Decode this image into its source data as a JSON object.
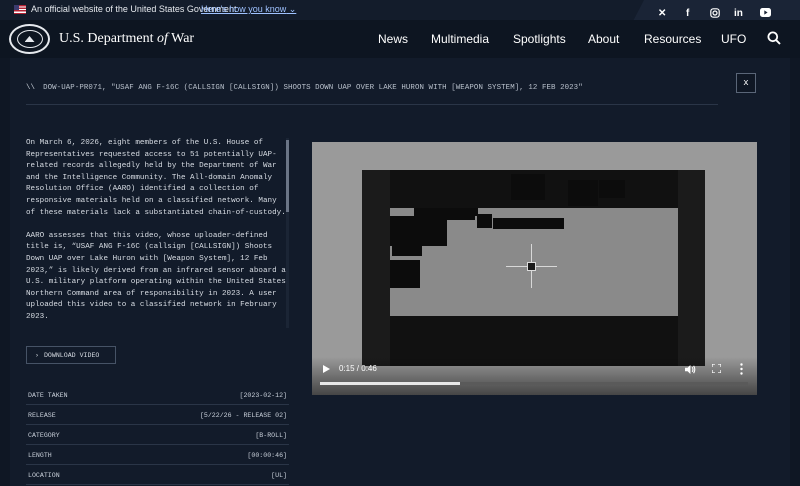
{
  "gov_banner": {
    "text": "An official website of the United States Government",
    "link": "Here's how you know",
    "social": [
      "X",
      "f",
      "instagram",
      "in",
      "youtube"
    ]
  },
  "header": {
    "site_title_pre": "U.S. Department ",
    "site_title_of": "of",
    "site_title_post": " War",
    "nav": [
      "News",
      "Multimedia",
      "Spotlights",
      "About",
      "Resources",
      "UFO"
    ]
  },
  "record": {
    "breadcrumb_slashes": "\\\\",
    "breadcrumb": "DOW-UAP-PR071, \"USAF ANG F-16C (CALLSIGN [CALLSIGN]) SHOOTS DOWN UAP OVER LAKE HURON WITH [WEAPON SYSTEM], 12 FEB 2023\"",
    "close_label": "x",
    "description": [
      "On March 6, 2026, eight members of the U.S. House of Representatives requested access to 51 potentially UAP-related records allegedly held by the Department of War and the Intelligence Community. The All-domain Anomaly Resolution Office (AARO) identified a collection of responsive materials held on a classified network. Many of these materials lack a substantiated chain-of-custody.",
      "AARO assesses that this video, whose uploader-defined title is, “USAF ANG F-16C (callsign [CALLSIGN]) Shoots Down UAP over Lake Huron with [Weapon System], 12 Feb 2023,” is likely derived from an infrared sensor aboard a U.S. military platform operating within the United States Northern Command area of responsibility in 2023. A user uploaded this video to a classified network in February 2023."
    ],
    "download_label": "DOWNLOAD VIDEO",
    "meta": [
      {
        "key": "DATE TAKEN",
        "value": "[2023-02-12]"
      },
      {
        "key": "RELEASE",
        "value": "[5/22/26 - RELEASE 02]"
      },
      {
        "key": "CATEGORY",
        "value": "[B-ROLL]"
      },
      {
        "key": "LENGTH",
        "value": "[00:00:46]"
      },
      {
        "key": "LOCATION",
        "value": "[UL]"
      }
    ]
  },
  "video": {
    "time": "0:15 / 0:46",
    "progress": 0.326
  },
  "colors": {
    "page_bg": "#0f1724",
    "panel_bg": "#121b2a",
    "link": "#9fc2ff"
  }
}
